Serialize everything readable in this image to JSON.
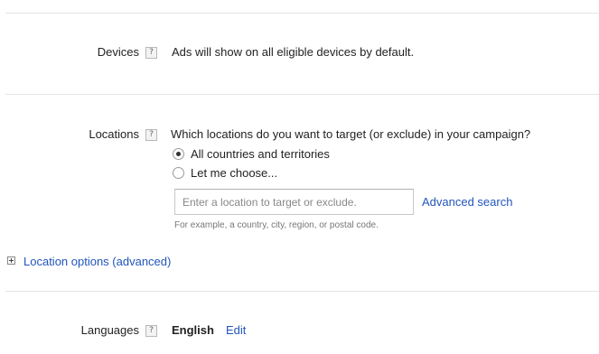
{
  "devices": {
    "label": "Devices",
    "help": "?",
    "description": "Ads will show on all eligible devices by default."
  },
  "locations": {
    "label": "Locations",
    "help": "?",
    "question": "Which locations do you want to target (or exclude) in your campaign?",
    "options": [
      {
        "label": "All countries and territories",
        "checked": true
      },
      {
        "label": "Let me choose...",
        "checked": false
      }
    ],
    "search": {
      "placeholder": "Enter a location to target or exclude.",
      "value": ""
    },
    "advanced_search": "Advanced search",
    "hint": "For example, a country, city, region, or postal code.",
    "options_toggle": "Location options (advanced)"
  },
  "languages": {
    "label": "Languages",
    "help": "?",
    "value": "English",
    "edit": "Edit"
  },
  "colors": {
    "link": "#2255bb",
    "divider": "#e5e5e5"
  }
}
